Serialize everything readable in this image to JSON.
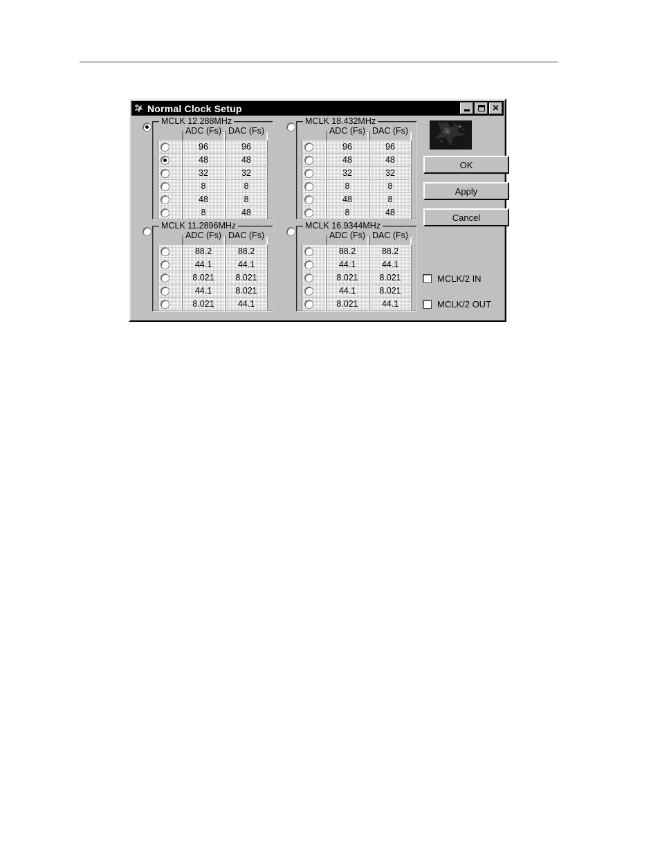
{
  "window": {
    "title": "Normal Clock Setup",
    "icon": "ti-logo-icon",
    "minimize_label": "_",
    "maximize_label": "□",
    "close_label": "✕"
  },
  "colors": {
    "dialog_face": "#c0c0c0",
    "titlebar": "#000000",
    "titlebar_text": "#ffffff",
    "cell_background": "#ffffff",
    "page_rule": "#c8c8c8"
  },
  "column_headers": {
    "adc": "ADC (Fs)",
    "dac": "DAC (Fs)"
  },
  "groups": [
    {
      "id": "mclk-12288",
      "label": "MCLK 12.288MHz",
      "group_selected": true,
      "rows": [
        {
          "adc": "96",
          "dac": "96",
          "selected": false
        },
        {
          "adc": "48",
          "dac": "48",
          "selected": true
        },
        {
          "adc": "32",
          "dac": "32",
          "selected": false
        },
        {
          "adc": "8",
          "dac": "8",
          "selected": false
        },
        {
          "adc": "48",
          "dac": "8",
          "selected": false
        },
        {
          "adc": "8",
          "dac": "48",
          "selected": false
        }
      ]
    },
    {
      "id": "mclk-18432",
      "label": "MCLK 18.432MHz",
      "group_selected": false,
      "rows": [
        {
          "adc": "96",
          "dac": "96",
          "selected": false
        },
        {
          "adc": "48",
          "dac": "48",
          "selected": false
        },
        {
          "adc": "32",
          "dac": "32",
          "selected": false
        },
        {
          "adc": "8",
          "dac": "8",
          "selected": false
        },
        {
          "adc": "48",
          "dac": "8",
          "selected": false
        },
        {
          "adc": "8",
          "dac": "48",
          "selected": false
        }
      ]
    },
    {
      "id": "mclk-112896",
      "label": "MCLK 11.2896MHz",
      "group_selected": false,
      "rows": [
        {
          "adc": "88.2",
          "dac": "88.2",
          "selected": false
        },
        {
          "adc": "44.1",
          "dac": "44.1",
          "selected": false
        },
        {
          "adc": "8.021",
          "dac": "8.021",
          "selected": false
        },
        {
          "adc": "44.1",
          "dac": "8.021",
          "selected": false
        },
        {
          "adc": "8.021",
          "dac": "44.1",
          "selected": false
        }
      ]
    },
    {
      "id": "mclk-169344",
      "label": "MCLK 16.9344MHz",
      "group_selected": false,
      "rows": [
        {
          "adc": "88.2",
          "dac": "88.2",
          "selected": false
        },
        {
          "adc": "44.1",
          "dac": "44.1",
          "selected": false
        },
        {
          "adc": "8.021",
          "dac": "8.021",
          "selected": false
        },
        {
          "adc": "44.1",
          "dac": "8.021",
          "selected": false
        },
        {
          "adc": "8.021",
          "dac": "44.1",
          "selected": false
        }
      ]
    }
  ],
  "buttons": {
    "ok": "OK",
    "apply": "Apply",
    "cancel": "Cancel"
  },
  "checkboxes": [
    {
      "id": "mclk2-in",
      "label": "MCLK/2 IN",
      "checked": false
    },
    {
      "id": "mclk2-out",
      "label": "MCLK/2 OUT",
      "checked": false
    }
  ]
}
